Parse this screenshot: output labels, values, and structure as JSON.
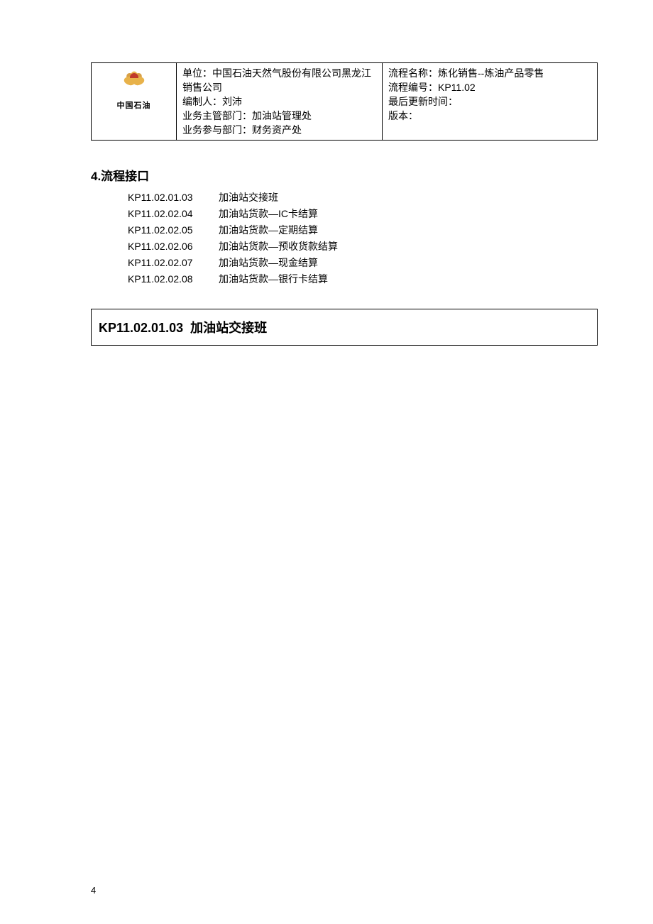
{
  "header": {
    "brand": "中国石油",
    "left": {
      "unit_label": "单位：",
      "unit_value": "中国石油天然气股份有限公司黑龙江销售公司",
      "author_label": "编制人：",
      "author_value": "刘沛",
      "dept1_label": "业务主管部门：",
      "dept1_value": "加油站管理处",
      "dept2_label": "业务参与部门：",
      "dept2_value": "财务资产处"
    },
    "right": {
      "proc_name_label": "流程名称：",
      "proc_name_value": "炼化销售--炼油产品零售",
      "proc_code_label": "流程编号：",
      "proc_code_value": "KP11.02",
      "updated_label": "最后更新时间：",
      "updated_value": "",
      "version_label": "版本：",
      "version_value": ""
    }
  },
  "section": {
    "title": "4.流程接口"
  },
  "list": [
    {
      "code": "KP11.02.01.03",
      "name": "加油站交接班"
    },
    {
      "code": "KP11.02.02.04",
      "name": "加油站货款—IC卡结算"
    },
    {
      "code": "KP11.02.02.05",
      "name": "加油站货款—定期结算"
    },
    {
      "code": "KP11.02.02.06",
      "name": "加油站货款—预收货款结算"
    },
    {
      "code": "KP11.02.02.07",
      "name": "加油站货款—现金结算"
    },
    {
      "code": "KP11.02.02.08",
      "name": "加油站货款—银行卡结算"
    }
  ],
  "box": {
    "code": "KP11.02.01.03",
    "title": "加油站交接班"
  },
  "page_number": "4"
}
